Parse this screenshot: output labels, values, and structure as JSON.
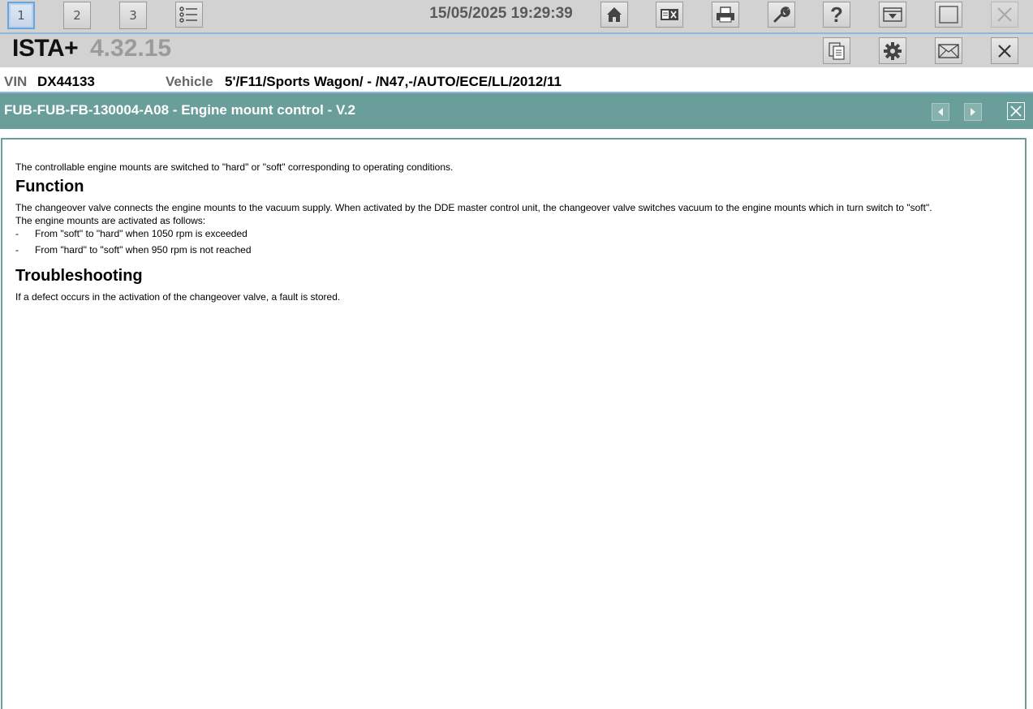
{
  "toolbar": {
    "tabs": [
      "1",
      "2",
      "3"
    ],
    "active_tab": "1",
    "datetime": "15/05/2025 19:29:39",
    "icons": [
      "list-icon",
      "home-icon",
      "tests-icon",
      "print-icon",
      "wrench-icon",
      "help-icon",
      "download-icon",
      "window-icon",
      "close-icon"
    ],
    "help_glyph": "?"
  },
  "title_bar": {
    "app_name": "ISTA+",
    "version": "4.32.15",
    "icons": [
      "copy-icon",
      "settings-icon",
      "mail-icon",
      "close-icon"
    ]
  },
  "vehicle": {
    "vin_label": "VIN",
    "vin": "DX44133",
    "vehicle_label": "Vehicle",
    "vehicle_value": "5'/F11/Sports Wagon/ - /N47,-/AUTO/ECE/LL/2012/11"
  },
  "document": {
    "title": "FUB-FUB-FB-130004-A08 - Engine mount control - V.2",
    "intro": "The controllable engine mounts are switched to \"hard\" or \"soft\" corresponding to operating conditions.",
    "function_heading": "Function",
    "function_text_1": "The changeover valve connects the engine mounts to the vacuum supply. When activated by the DDE master control unit, the changeover valve switches vacuum to the engine mounts which in turn switch to \"soft\".",
    "function_text_2": "The engine mounts are activated as follows:",
    "bullets": [
      "From \"soft\" to \"hard\" when 1050 rpm is exceeded",
      "From \"hard\" to \"soft\" when 950 rpm is not reached"
    ],
    "bullet_marker": "-",
    "troubleshooting_heading": "Troubleshooting",
    "troubleshooting_text": "If a defect occurs in the activation of the changeover valve, a fault is stored."
  },
  "colors": {
    "toolbar_bg": "#d2d2d2",
    "accent_line": "#8db7dc",
    "header_teal": "#6a9e9a"
  }
}
